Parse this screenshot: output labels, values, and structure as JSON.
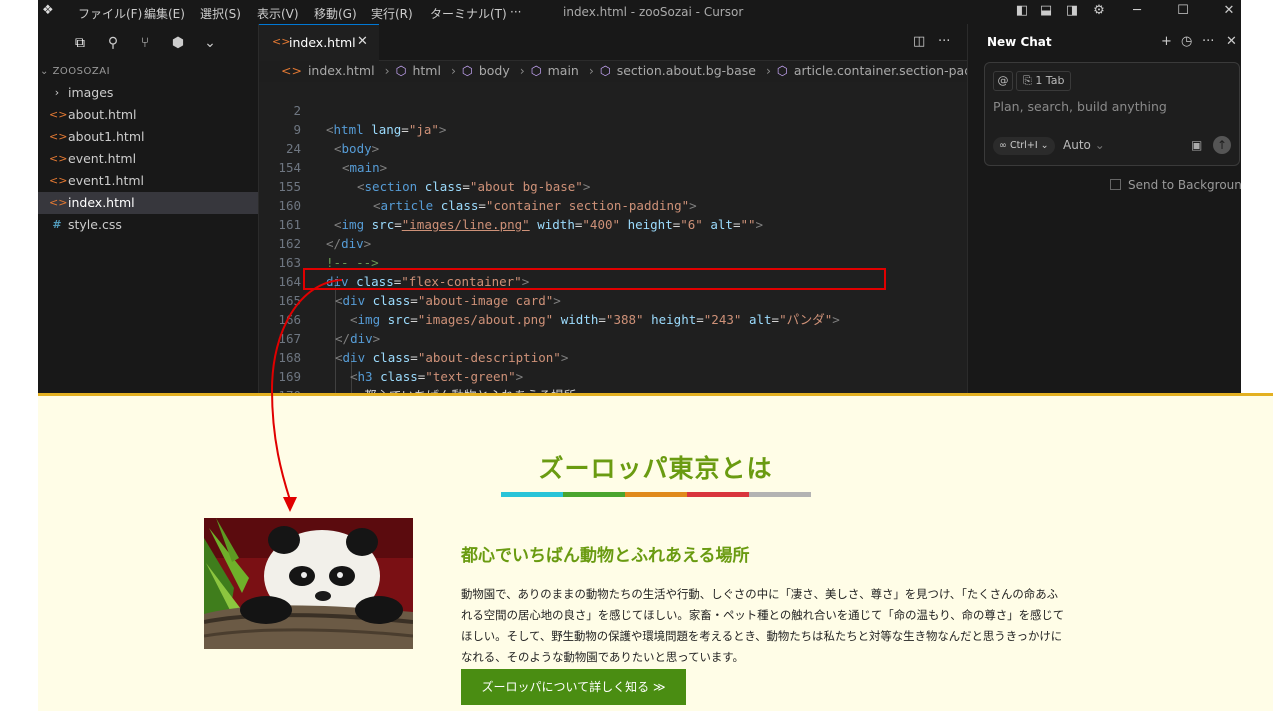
{
  "titlebar": {
    "menus": [
      "ファイル(F)",
      "編集(E)",
      "選択(S)",
      "表示(V)",
      "移動(G)",
      "実行(R)",
      "ターミナル(T)",
      "···"
    ],
    "window_title": "index.html - zooSozai - Cursor"
  },
  "explorer": {
    "root": "ZOOSOZAI",
    "items": [
      {
        "label": "images",
        "kind": "folder"
      },
      {
        "label": "about.html",
        "kind": "html"
      },
      {
        "label": "about1.html",
        "kind": "html"
      },
      {
        "label": "event.html",
        "kind": "html"
      },
      {
        "label": "event1.html",
        "kind": "html"
      },
      {
        "label": "index.html",
        "kind": "html",
        "selected": true
      },
      {
        "label": "style.css",
        "kind": "css"
      }
    ]
  },
  "editor": {
    "tab_label": "index.html",
    "breadcrumb": [
      "index.html",
      "html",
      "body",
      "main",
      "section.about.bg-base",
      "article.container.section-padding"
    ],
    "line_numbers": [
      "2",
      "9",
      "24",
      "154",
      "155",
      "160",
      "161",
      "162",
      "163",
      "164",
      "165",
      "166",
      "167",
      "168",
      "169",
      "170"
    ],
    "code": {
      "l2_lang": "\"ja\"",
      "l154_class": "\"about bg-base\"",
      "l155_class": "\"container section-padding\"",
      "l160_src": "\"images/line.png\"",
      "l160_width": "\"400\"",
      "l160_height": "\"6\"",
      "l160_alt": "\"\"",
      "l162_comment": "!-- -->",
      "l163_class": "\"flex-container\"",
      "l164_class": "\"about-image card\"",
      "l165_src": "\"images/about.png\"",
      "l165_width": "\"388\"",
      "l165_height": "\"243\"",
      "l165_alt": "\"パンダ\"",
      "l167_class": "\"about-description\"",
      "l168_class": "\"text-green\"",
      "l169_text": "都心でいちばん動物とふれあえる場所"
    }
  },
  "chat": {
    "title": "New Chat",
    "tab_chip": "1 Tab",
    "input_placeholder": "Plan, search, build anything",
    "mode_chip": "Ctrl+I",
    "model": "Auto",
    "background_label": "Send to Background"
  },
  "webpage": {
    "title": "ズーロッパ東京とは",
    "stripe_colors": [
      "#29c4d8",
      "#4aa52e",
      "#e08a1c",
      "#d9353d",
      "#b3b3b3"
    ],
    "subtitle": "都心でいちばん動物とふれあえる場所",
    "body_lines": [
      "動物園で、ありのままの動物たちの生活や行動、しぐさの中に「凄さ、美しさ、尊さ」を見つけ、「たくさんの命あふ",
      "れる空間の居心地の良さ」を感じてほしい。家畜・ペット種との触れ合いを通じて「命の温もり、命の尊さ」を感じて",
      "ほしい。そして、野生動物の保護や環境問題を考えるとき、動物たちは私たちと対等な生き物なんだと思うきっかけに",
      "なれる、そのような動物園でありたいと思っています。"
    ],
    "button_label": "ズーロッパについて詳しく知る ≫"
  },
  "accent_colors": {
    "annotation_red": "#e00000",
    "editor_bg": "#1e1e1e",
    "page_bg": "#fffde7",
    "green_heading": "#6a9b11"
  }
}
